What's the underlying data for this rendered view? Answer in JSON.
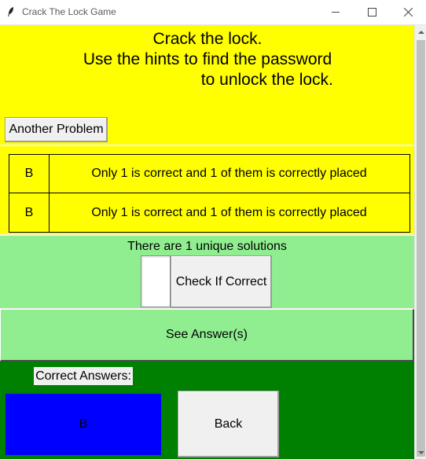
{
  "window": {
    "title": "Crack The Lock Game",
    "controls": [
      "minimize",
      "maximize",
      "close"
    ]
  },
  "instructions": {
    "text": "Crack the lock.\nUse the hints to find the password\n                          to unlock the lock."
  },
  "buttons": {
    "another_problem": "Another Problem",
    "check_if_correct": "Check If Correct",
    "see_answers": "See Answer(s)",
    "back": "Back"
  },
  "hints": [
    {
      "code": "B",
      "text": "Only 1 is correct and 1 of them is correctly placed"
    },
    {
      "code": "B",
      "text": "Only 1 is correct and 1 of them is correctly placed"
    }
  ],
  "solution": {
    "count_text": "There are 1 unique solutions",
    "input_value": ""
  },
  "answers": {
    "label": "Correct Answers:",
    "value": "B"
  },
  "colors": {
    "instructions_bg": "#ffff00",
    "solution_bg": "#90ee90",
    "answers_bg": "#008000",
    "answer_box": "#0000ff"
  },
  "icons": {
    "app": "feather-icon",
    "minimize": "minimize-icon",
    "maximize": "maximize-icon",
    "close": "close-icon"
  }
}
